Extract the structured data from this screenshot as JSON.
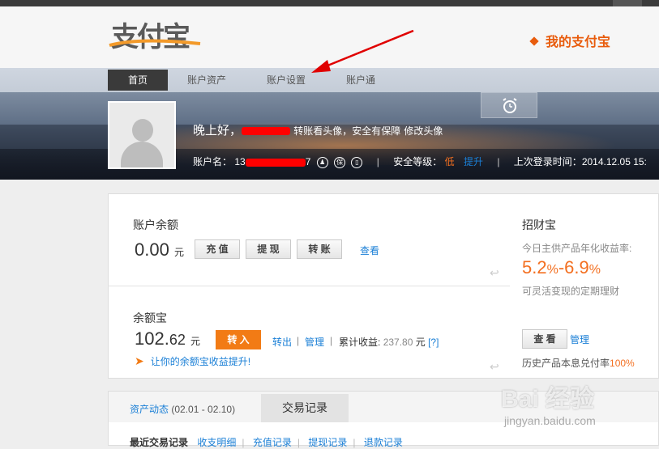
{
  "brand": {
    "logo_text": "支付宝",
    "my_alipay": "我的支付宝",
    "accent": "#e85c0d"
  },
  "nav": {
    "items": [
      {
        "label": "首页"
      },
      {
        "label": "账户资产"
      },
      {
        "label": "账户设置"
      },
      {
        "label": "账户通"
      }
    ]
  },
  "profile": {
    "greeting_prefix": "晚上好，",
    "greeting_hint": "转账看头像，安全有保障",
    "edit_avatar": "修改头像",
    "account_label": "账户名：",
    "account_prefix": "13",
    "account_suffix": "7",
    "security_label": "安全等级：",
    "security_level": "低",
    "security_upgrade": "提升",
    "last_login_label": "上次登录时间：",
    "last_login_value": "2014.12.05 15:"
  },
  "balance": {
    "title": "账户余额",
    "amount_int": "0.",
    "amount_dec": "00",
    "unit": "元",
    "btn_recharge": "充 值",
    "btn_withdraw": "提 现",
    "btn_transfer": "转 账",
    "view": "查看"
  },
  "yuebao": {
    "title": "余额宝",
    "amount_int": "102.",
    "amount_dec": "62",
    "unit": "元",
    "btn_in": "转 入",
    "out": "转出",
    "manage": "管理",
    "cum_label": "累计收益:",
    "cum_value": "237.80",
    "cum_unit": "元",
    "help": "[?]",
    "promo": "让你的余额宝收益提升!"
  },
  "zhaocaibao": {
    "title": "招财宝",
    "rate_label": "今日主供产品年化收益率:",
    "rate_low": "5.2",
    "rate_high": "6.9",
    "pct": "%",
    "dash": "-",
    "desc": "可灵活变现的定期理财",
    "btn_view": "查 看",
    "manage": "管理",
    "history_label": "历史产品本息兑付率",
    "history_value": "100%"
  },
  "tabs": {
    "dynamics": "资产动态",
    "range": "(02.01 - 02.10)",
    "records": "交易记录"
  },
  "recent": {
    "title": "最近交易记录",
    "links": [
      "收支明细",
      "充值记录",
      "提现记录",
      "退款记录"
    ]
  },
  "watermark": {
    "main": "Bai 经验",
    "sub": "jingyan.baidu.com"
  }
}
